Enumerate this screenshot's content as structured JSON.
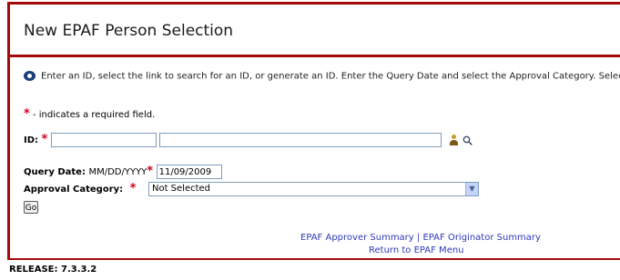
{
  "header": {
    "title": "New EPAF Person Selection"
  },
  "info": {
    "icon": "info-icon",
    "text": "Enter an ID, select the link to search for an ID, or generate an ID. Enter the Query Date and select the Approval Category. Select Go"
  },
  "required_note": {
    "star": "*",
    "text": " - indicates a required field."
  },
  "id_field": {
    "label": "ID:",
    "star": "*",
    "value1": "",
    "value2": "",
    "person_icon": "person-icon",
    "search_icon": "search-icon"
  },
  "query_date": {
    "label": "Query Date:",
    "format": "MM/DD/YYYY",
    "star": "*",
    "value": "11/09/2009"
  },
  "approval_category": {
    "label": "Approval Category:",
    "star": "*",
    "selected": "Not Selected"
  },
  "go_button": {
    "label": "Go"
  },
  "links": {
    "approver_summary": "EPAF Approver Summary",
    "separator": "|",
    "originator_summary": "EPAF Originator Summary",
    "return_menu": "Return to EPAF Menu"
  },
  "footer": {
    "release": "RELEASE: 7.3.3.2"
  },
  "colors": {
    "accent": "#a50a0a",
    "link": "#2f3ab8",
    "required": "#d0021b"
  }
}
